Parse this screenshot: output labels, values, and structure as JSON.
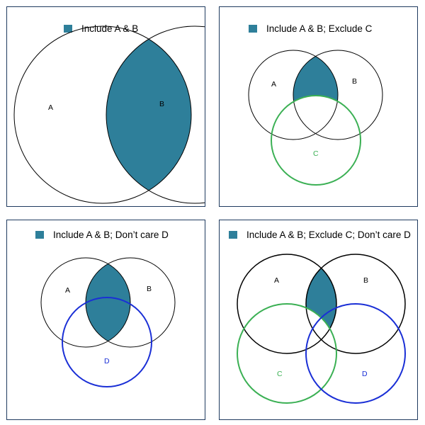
{
  "colors": {
    "fill": "#2e7f9a",
    "A": "#000000",
    "B": "#000000",
    "C": "#3bb054",
    "D": "#1a2fd6"
  },
  "panels": [
    {
      "legend": "Include A & B",
      "labels": {
        "A": "A",
        "B": "B"
      }
    },
    {
      "legend": "Include A & B; Exclude C",
      "labels": {
        "A": "A",
        "B": "B",
        "C": "C"
      }
    },
    {
      "legend": "Include A & B; Don’t care D",
      "labels": {
        "A": "A",
        "B": "B",
        "D": "D"
      }
    },
    {
      "legend": "Include A & B; Exclude C; Don’t care D",
      "labels": {
        "A": "A",
        "B": "B",
        "C": "C",
        "D": "D"
      }
    }
  ]
}
